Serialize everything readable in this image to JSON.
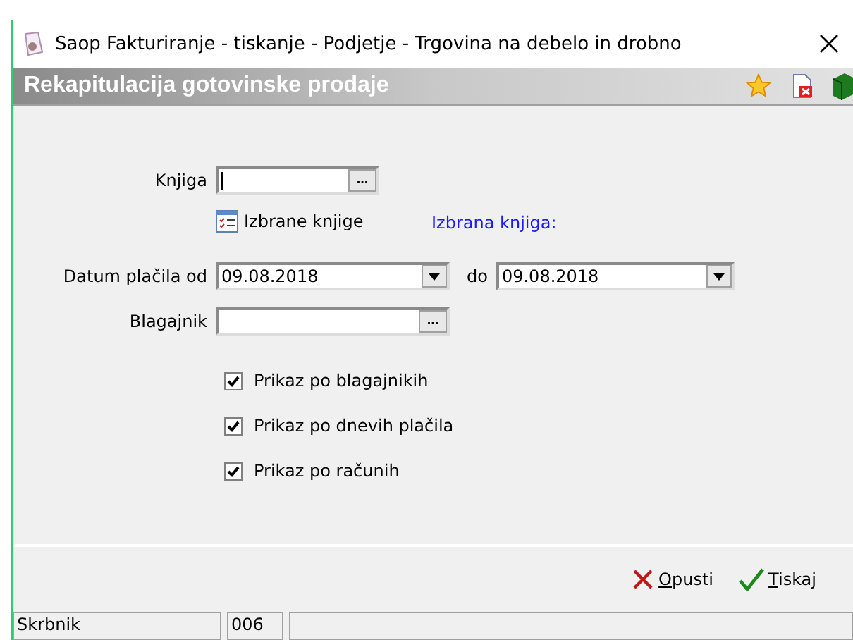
{
  "window": {
    "title": "Saop Fakturiranje - tiskanje - Podjetje - Trgovina na debelo in drobno"
  },
  "header": {
    "title": "Rekapitulacija gotovinske prodaje"
  },
  "form": {
    "book": {
      "label": "Knjiga",
      "button": "..."
    },
    "selected_books_link": "Izbrane knjige",
    "selected_book_label": "Izbrana knjiga:",
    "date_from": {
      "label": "Datum plačila od",
      "value": "09.08.2018"
    },
    "date_to": {
      "label": "do",
      "value": "09.08.2018"
    },
    "cashier": {
      "label": "Blagajnik",
      "button": "..."
    },
    "options": [
      {
        "label": "Prikaz po blagajnikih",
        "checked": true
      },
      {
        "label": "Prikaz po dnevih plačila",
        "checked": true
      },
      {
        "label": "Prikaz po računih",
        "checked": true
      }
    ]
  },
  "buttons": [
    {
      "kind": "cancel",
      "label": "Opusti"
    },
    {
      "kind": "print",
      "label": "Tiskaj"
    }
  ],
  "status_bar": [
    "Skrbnik",
    "006"
  ]
}
